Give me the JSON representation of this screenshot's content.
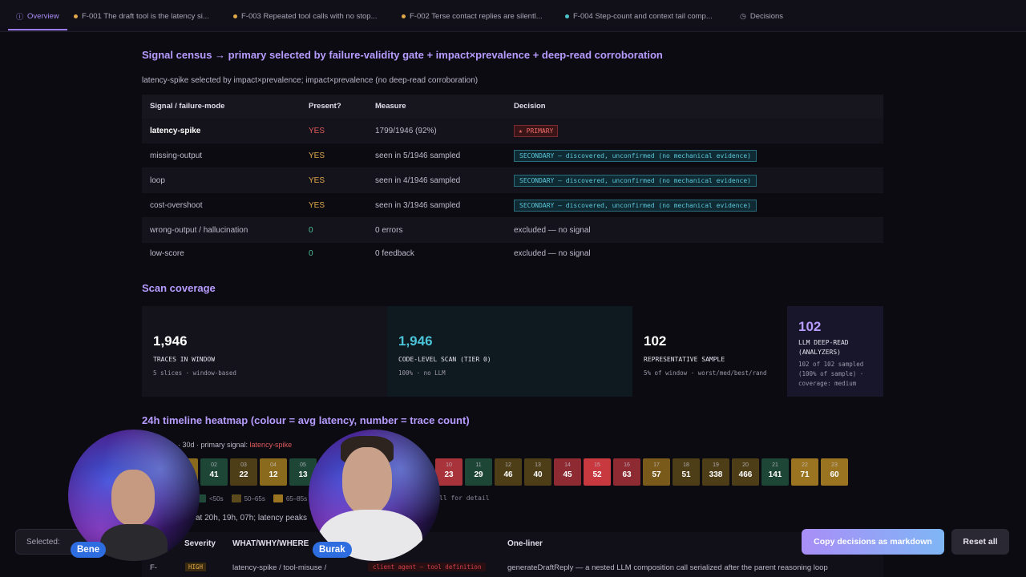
{
  "tabs": [
    {
      "label": "Overview",
      "icon": "info-icon",
      "color": "#a98ef7",
      "active": true
    },
    {
      "label": "F-001 The draft tool is the latency si...",
      "color": "#e0a84a"
    },
    {
      "label": "F-003 Repeated tool calls with no stop...",
      "color": "#e0a84a"
    },
    {
      "label": "F-002 Terse contact replies are silentl...",
      "color": "#e0a84a"
    },
    {
      "label": "F-004 Step-count and context tail comp...",
      "color": "#4bc3c8"
    },
    {
      "label": "Decisions",
      "icon": "clock-icon"
    }
  ],
  "census": {
    "title": "Signal census → primary selected by failure-validity gate + impact×prevalence + deep-read corroboration",
    "subtitle": "latency-spike selected by impact×prevalence; impact×prevalence (no deep-read corroboration)",
    "headers": [
      "Signal / failure-mode",
      "Present?",
      "Measure",
      "Decision"
    ],
    "rows": [
      {
        "signal": "latency-spike",
        "present": "YES",
        "measure": "1799/1946 (92%)",
        "decision": "★ PRIMARY",
        "kind": "primary"
      },
      {
        "signal": "missing-output",
        "present": "YES",
        "measure": "seen in 5/1946 sampled",
        "decision": "SECONDARY — discovered, unconfirmed (no mechanical evidence)",
        "kind": "secondary"
      },
      {
        "signal": "loop",
        "present": "YES",
        "measure": "seen in 4/1946 sampled",
        "decision": "SECONDARY — discovered, unconfirmed (no mechanical evidence)",
        "kind": "secondary"
      },
      {
        "signal": "cost-overshoot",
        "present": "YES",
        "measure": "seen in 3/1946 sampled",
        "decision": "SECONDARY — discovered, unconfirmed (no mechanical evidence)",
        "kind": "secondary"
      },
      {
        "signal": "wrong-output / hallucination",
        "present": "0",
        "measure": "0 errors",
        "decision": "excluded — no signal",
        "kind": "excluded"
      },
      {
        "signal": "low-score",
        "present": "0",
        "measure": "0 feedback",
        "decision": "excluded — no signal",
        "kind": "excluded"
      }
    ]
  },
  "coverage": {
    "title": "Scan coverage",
    "cards": [
      {
        "value": "1,946",
        "label": "TRACES IN WINDOW",
        "detail": "5 slices · window-based",
        "color": "#ffffff"
      },
      {
        "value": "1,946",
        "label": "CODE-LEVEL SCAN (TIER 0)",
        "detail": "100% · no LLM",
        "color": "#4bc3d8"
      },
      {
        "value": "102",
        "label": "REPRESENTATIVE SAMPLE",
        "detail": "5% of window · worst/med/best/rand",
        "color": "#ffffff"
      },
      {
        "value": "102",
        "label": "LLM DEEP-READ (ANALYZERS)",
        "detail": "102 of 102 sampled (100% of sample) · coverage: medium",
        "color": "#b79cff"
      }
    ]
  },
  "heatmap": {
    "title": "24h timeline heatmap (colour = avg latency, number = trace count)",
    "caption_prefix": "· 30d · primary signal:",
    "caption_signal": "latency-spike",
    "click_hint": "ll for detail",
    "legend": [
      {
        "label": "<50s",
        "color": "#1f4a3a"
      },
      {
        "label": "50–65s",
        "color": "#5a4a1c"
      },
      {
        "label": "65–85s",
        "color": "#9a7420"
      }
    ],
    "note": "at 20h, 19h, 07h; latency peaks",
    "cells": [
      {
        "hour": "",
        "count": "",
        "color": "#8a6a1c"
      },
      {
        "hour": "02",
        "count": "41",
        "color": "#1e4636"
      },
      {
        "hour": "03",
        "count": "22",
        "color": "#4d3e18"
      },
      {
        "hour": "04",
        "count": "12",
        "color": "#8a6a1c"
      },
      {
        "hour": "05",
        "count": "13",
        "color": "#1e4636"
      },
      {
        "hour": "10",
        "count": "23",
        "color": "#a8333a"
      },
      {
        "hour": "11",
        "count": "29",
        "color": "#1e4636"
      },
      {
        "hour": "12",
        "count": "46",
        "color": "#4d3e18"
      },
      {
        "hour": "13",
        "count": "40",
        "color": "#4d3e18"
      },
      {
        "hour": "14",
        "count": "45",
        "color": "#8e2a32"
      },
      {
        "hour": "15",
        "count": "52",
        "color": "#c8383f"
      },
      {
        "hour": "16",
        "count": "63",
        "color": "#8e2a32"
      },
      {
        "hour": "17",
        "count": "57",
        "color": "#7a5a1a"
      },
      {
        "hour": "18",
        "count": "51",
        "color": "#4d3e18"
      },
      {
        "hour": "19",
        "count": "338",
        "color": "#4d3e18"
      },
      {
        "hour": "20",
        "count": "466",
        "color": "#4d3e18"
      },
      {
        "hour": "21",
        "count": "141",
        "color": "#1e4636"
      },
      {
        "hour": "22",
        "count": "71",
        "color": "#9a7420"
      },
      {
        "hour": "23",
        "count": "60",
        "color": "#9a7420"
      }
    ]
  },
  "findings": {
    "headers": [
      "Severity",
      "WHAT/WHY/WHERE",
      "One-liner"
    ],
    "row": {
      "id": "F-",
      "severity": "HIGH",
      "what": "latency-spike / tool-misuse /",
      "where": "client agent — tool definition",
      "oneliner": "generateDraftReply — a nested LLM composition call serialized after the parent reasoning loop"
    }
  },
  "bottom": {
    "selected_label": "Selected:",
    "copy_label": "Copy decisions as markdown",
    "reset_label": "Reset all"
  },
  "participants": [
    {
      "name": "Bene"
    },
    {
      "name": "Burak"
    }
  ]
}
